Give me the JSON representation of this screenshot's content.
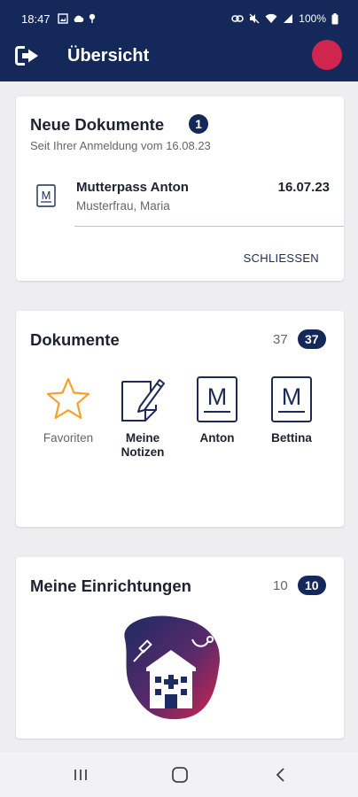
{
  "status_bar": {
    "time": "18:47",
    "battery": "100%"
  },
  "app_bar": {
    "title": "Übersicht"
  },
  "new_documents": {
    "title": "Neue Dokumente",
    "badge": "1",
    "subtitle": "Seit Ihrer Anmeldung vom 16.08.23",
    "items": [
      {
        "name": "Mutterpass Anton",
        "author": "Musterfrau, Maria",
        "date": "16.07.23",
        "icon": "mutterpass-icon"
      }
    ],
    "close_label": "SCHLIESSEN"
  },
  "documents": {
    "title": "Dokumente",
    "count": "37",
    "badge": "37",
    "categories": [
      {
        "label": "Favoriten",
        "icon": "star-icon"
      },
      {
        "label": "Meine Notizen",
        "icon": "notes-icon"
      },
      {
        "label": "Anton",
        "icon": "mutterpass-icon"
      },
      {
        "label": "Bettina",
        "icon": "mutterpass-icon"
      }
    ]
  },
  "institutions": {
    "title": "Meine Einrichtungen",
    "count": "10",
    "badge": "10",
    "illustration": "hospital-icon"
  },
  "colors": {
    "primary": "#15285a",
    "accent": "#d0254f",
    "star": "#f4a12c"
  },
  "nav_bar": {
    "icons": [
      "recents-icon",
      "home-icon",
      "back-icon"
    ]
  }
}
